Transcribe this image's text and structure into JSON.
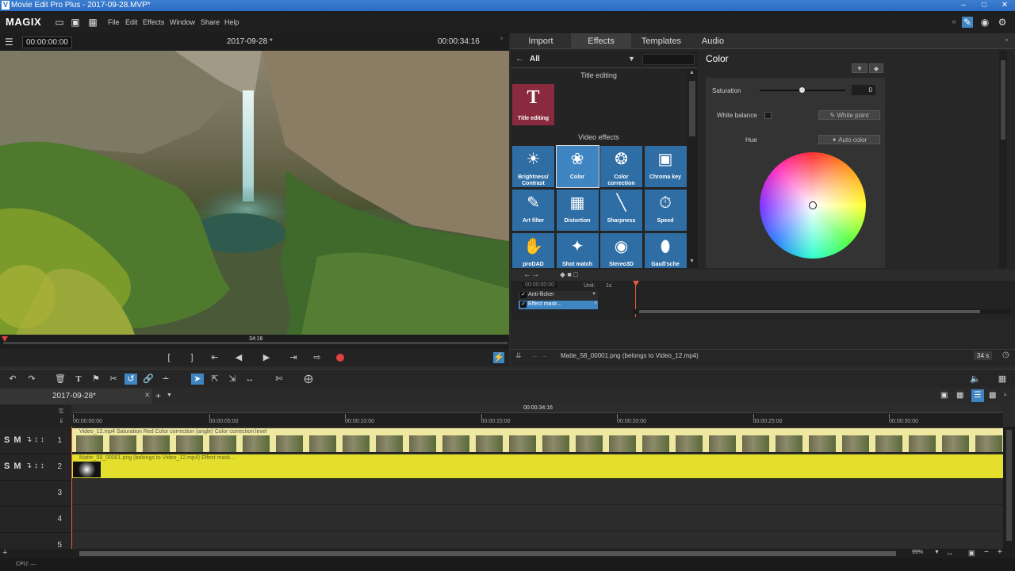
{
  "window": {
    "title": "Movie Edit Pro Plus - 2017-09-28.MVP*"
  },
  "menubar": {
    "logo": "MAGIX",
    "items": [
      "File",
      "Edit",
      "Effects",
      "Window",
      "Share",
      "Help"
    ]
  },
  "preview": {
    "timecode_left": "00:00:00:00",
    "project_name": "2017-09-28 *",
    "timecode_right": "00:00:34:16",
    "scrub_label": "34:16"
  },
  "tabs": [
    "Import",
    "Effects",
    "Templates",
    "Audio"
  ],
  "effects": {
    "filter": "All",
    "section_title": "Title editing",
    "title_tile": "Title editing",
    "section_video": "Video effects",
    "tiles": [
      {
        "label": "Brightness/ Contrast",
        "icon": "sun-icon"
      },
      {
        "label": "Color",
        "icon": "palette-icon"
      },
      {
        "label": "Color correction",
        "icon": "color-correction-icon"
      },
      {
        "label": "Chroma key",
        "icon": "chroma-key-icon"
      },
      {
        "label": "Art filter",
        "icon": "art-filter-icon"
      },
      {
        "label": "Distortion",
        "icon": "distortion-icon"
      },
      {
        "label": "Sharpness",
        "icon": "sharpness-icon"
      },
      {
        "label": "Speed",
        "icon": "speed-icon"
      },
      {
        "label": "proDAD",
        "icon": "hand-icon"
      },
      {
        "label": "Shot match",
        "icon": "shot-match-icon"
      },
      {
        "label": "Stereo3D",
        "icon": "eye-icon"
      },
      {
        "label": "Gauß'sche",
        "icon": "drop-icon"
      }
    ]
  },
  "color_panel": {
    "header": "Color",
    "saturation_label": "Saturation",
    "saturation_value": "0",
    "white_balance_label": "White balance",
    "white_point_button": "White point",
    "hue_label": "Hue",
    "auto_color_button": "Auto color"
  },
  "mini_timeline": {
    "timecode": "00:00:00:00",
    "unit_label": "Unit:",
    "unit_value": "1s",
    "rows": [
      "Anti-flicker",
      "Effect mask..."
    ]
  },
  "right_status": {
    "text": "Matte_58_00001.png (belongs to Video_12.mp4)",
    "duration": "34 s"
  },
  "project_tab": "2017-09-28*",
  "ruler": {
    "position": "00:00:34:16",
    "ticks": [
      "00:00:00:00",
      "00:00:05:00",
      "00:00:10:00",
      "00:00:15:00",
      "00:00:20:00",
      "00:00:25:00",
      "00:00:30:00"
    ]
  },
  "tracks": [
    {
      "num": "1",
      "label": "Video_12.mp4  Saturation  Red  Color correction (angle)  Color correction level"
    },
    {
      "num": "2",
      "label": "Matte_58_00001.png (belongs to Video_12.mp4) Effect mask..."
    },
    {
      "num": "3",
      "label": ""
    },
    {
      "num": "4",
      "label": ""
    },
    {
      "num": "5",
      "label": ""
    }
  ],
  "track_controls": "S M",
  "zoom": "99%",
  "status": "CPU: —",
  "colors": {
    "accent": "#3f85c2",
    "clip_yellow": "#e8e23a",
    "record_red": "#e04040"
  }
}
